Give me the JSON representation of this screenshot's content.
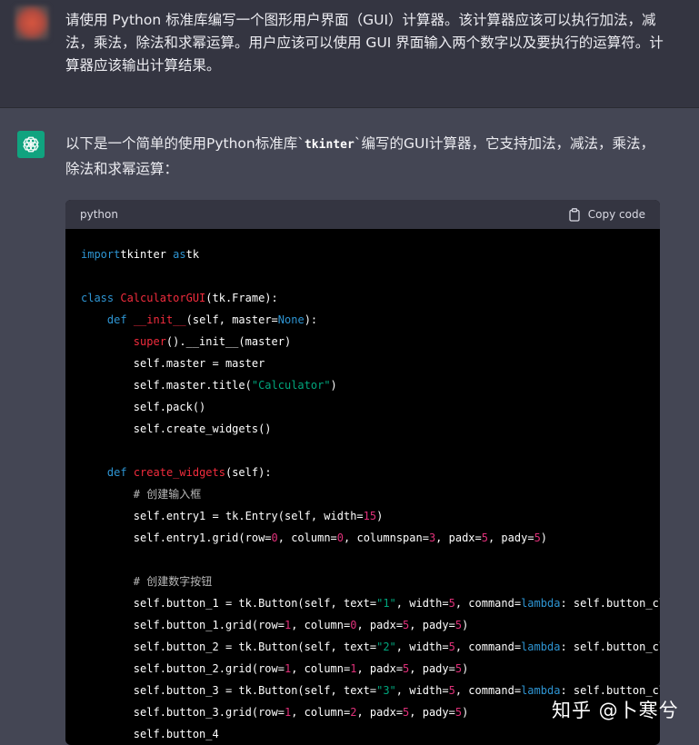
{
  "user_message": {
    "text": "请使用 Python 标准库编写一个图形用户界面（GUI）计算器。该计算器应该可以执行加法，减法，乘法，除法和求幂运算。用户应该可以使用 GUI 界面输入两个数字以及要执行的运算符。计算器应该输出计算结果。"
  },
  "assistant_message": {
    "intro_before": "以下是一个简单的使用Python标准库`",
    "intro_code": "tkinter",
    "intro_after": "`编写的GUI计算器，它支持加法，减法，乘法，除法和求幂运算："
  },
  "code_block": {
    "language": "python",
    "copy_label": "Copy code",
    "lines": [
      [
        [
          "kw",
          "import"
        ],
        [
          "",
          "tkinter "
        ],
        [
          "kw",
          "as"
        ],
        [
          "",
          "tk"
        ]
      ],
      [],
      [
        [
          "kw",
          "class"
        ],
        [
          "",
          ""
        ],
        [
          "cls",
          "CalculatorGUI"
        ],
        [
          "",
          "(tk.Frame):"
        ]
      ],
      [
        [
          "",
          "    "
        ],
        [
          "kw",
          "def"
        ],
        [
          "",
          ""
        ],
        [
          "cls",
          "__init__"
        ],
        [
          "",
          "(self, master="
        ],
        [
          "kw",
          "None"
        ],
        [
          "",
          "):"
        ]
      ],
      [
        [
          "",
          "        "
        ],
        [
          "cls",
          "super"
        ],
        [
          "",
          "().__init__(master)"
        ]
      ],
      [
        [
          "",
          "        self.master = master"
        ]
      ],
      [
        [
          "",
          "        self.master.title("
        ],
        [
          "str",
          "\"Calculator\""
        ],
        [
          "",
          ")"
        ]
      ],
      [
        [
          "",
          "        self.pack()"
        ]
      ],
      [
        [
          "",
          "        self.create_widgets()"
        ]
      ],
      [],
      [
        [
          "",
          "    "
        ],
        [
          "kw",
          "def"
        ],
        [
          "",
          ""
        ],
        [
          "cls",
          "create_widgets"
        ],
        [
          "",
          "(self):"
        ]
      ],
      [
        [
          "",
          "        "
        ],
        [
          "cmt",
          "# 创建输入框"
        ]
      ],
      [
        [
          "",
          "        self.entry1 = tk.Entry(self, width="
        ],
        [
          "num",
          "15"
        ],
        [
          "",
          ")"
        ]
      ],
      [
        [
          "",
          "        self.entry1.grid(row="
        ],
        [
          "num",
          "0"
        ],
        [
          "",
          ", column="
        ],
        [
          "num",
          "0"
        ],
        [
          "",
          ", columnspan="
        ],
        [
          "num",
          "3"
        ],
        [
          "",
          ", padx="
        ],
        [
          "num",
          "5"
        ],
        [
          "",
          ", pady="
        ],
        [
          "num",
          "5"
        ],
        [
          "",
          ")"
        ]
      ],
      [],
      [
        [
          "",
          "        "
        ],
        [
          "cmt",
          "# 创建数字按钮"
        ]
      ],
      [
        [
          "",
          "        self.button_1 = tk.Button(self, text="
        ],
        [
          "str",
          "\"1\""
        ],
        [
          "",
          ", width="
        ],
        [
          "num",
          "5"
        ],
        [
          "",
          ", command="
        ],
        [
          "kw",
          "lambda"
        ],
        [
          "",
          ": self.button_clic"
        ]
      ],
      [
        [
          "",
          "        self.button_1.grid(row="
        ],
        [
          "num",
          "1"
        ],
        [
          "",
          ", column="
        ],
        [
          "num",
          "0"
        ],
        [
          "",
          ", padx="
        ],
        [
          "num",
          "5"
        ],
        [
          "",
          ", pady="
        ],
        [
          "num",
          "5"
        ],
        [
          "",
          ")"
        ]
      ],
      [
        [
          "",
          "        self.button_2 = tk.Button(self, text="
        ],
        [
          "str",
          "\"2\""
        ],
        [
          "",
          ", width="
        ],
        [
          "num",
          "5"
        ],
        [
          "",
          ", command="
        ],
        [
          "kw",
          "lambda"
        ],
        [
          "",
          ": self.button_clic"
        ]
      ],
      [
        [
          "",
          "        self.button_2.grid(row="
        ],
        [
          "num",
          "1"
        ],
        [
          "",
          ", column="
        ],
        [
          "num",
          "1"
        ],
        [
          "",
          ", padx="
        ],
        [
          "num",
          "5"
        ],
        [
          "",
          ", pady="
        ],
        [
          "num",
          "5"
        ],
        [
          "",
          ")"
        ]
      ],
      [
        [
          "",
          "        self.button_3 = tk.Button(self, text="
        ],
        [
          "str",
          "\"3\""
        ],
        [
          "",
          ", width="
        ],
        [
          "num",
          "5"
        ],
        [
          "",
          ", command="
        ],
        [
          "kw",
          "lambda"
        ],
        [
          "",
          ": self.button_clic"
        ]
      ],
      [
        [
          "",
          "        self.button_3.grid(row="
        ],
        [
          "num",
          "1"
        ],
        [
          "",
          ", column="
        ],
        [
          "num",
          "2"
        ],
        [
          "",
          ", padx="
        ],
        [
          "num",
          "5"
        ],
        [
          "",
          ", pady="
        ],
        [
          "num",
          "5"
        ],
        [
          "",
          ")"
        ]
      ],
      [
        [
          "",
          "        self.button_4"
        ]
      ]
    ]
  },
  "watermark": {
    "text": "知乎 @卜寒兮"
  }
}
